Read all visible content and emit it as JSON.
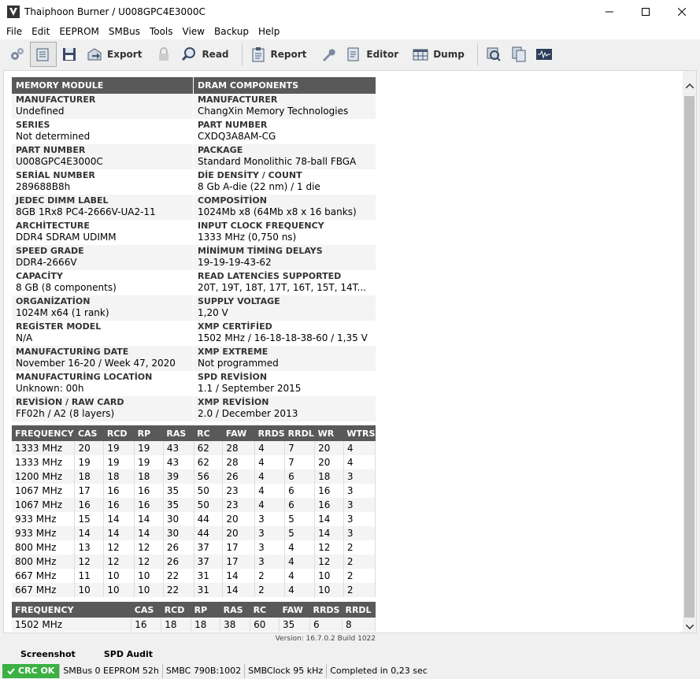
{
  "window": {
    "title": "Thaiphoon Burner / U008GPC4E3000C"
  },
  "menu": [
    "File",
    "Edit",
    "EEPROM",
    "SMBus",
    "Tools",
    "View",
    "Backup",
    "Help"
  ],
  "toolbar": {
    "export": "Export",
    "read": "Read",
    "report": "Report",
    "editor": "Editor",
    "dump": "Dump"
  },
  "headers": {
    "left": "MEMORY MODULE",
    "right": "DRAM COMPONENTS"
  },
  "pairs": [
    [
      {
        "label": "MANUFACTURER",
        "value": "Undefined"
      },
      {
        "label": "MANUFACTURER",
        "value": "ChangXin Memory Technologies"
      }
    ],
    [
      {
        "label": "SERIES",
        "value": "Not determined"
      },
      {
        "label": "PART NUMBER",
        "value": "CXDQ3A8AM-CG"
      }
    ],
    [
      {
        "label": "PART NUMBER",
        "value": "U008GPC4E3000C"
      },
      {
        "label": "PACKAGE",
        "value": "Standard Monolithic 78-ball FBGA"
      }
    ],
    [
      {
        "label": "SERİAL NUMBER",
        "value": "289688B8h"
      },
      {
        "label": "DİE DENSİTY / COUNT",
        "value": "8 Gb A-die (22 nm) / 1 die"
      }
    ],
    [
      {
        "label": "JEDEC DIMM LABEL",
        "value": "8GB 1Rx8 PC4-2666V-UA2-11"
      },
      {
        "label": "COMPOSİTİON",
        "value": "1024Mb x8 (64Mb x8 x 16 banks)"
      }
    ],
    [
      {
        "label": "ARCHİTECTURE",
        "value": "DDR4 SDRAM UDIMM"
      },
      {
        "label": "INPUT CLOCK FREQUENCY",
        "value": "1333 MHz (0,750 ns)"
      }
    ],
    [
      {
        "label": "SPEED GRADE",
        "value": "DDR4-2666V"
      },
      {
        "label": "MİNİMUM TİMİNG DELAYS",
        "value": "19-19-19-43-62"
      }
    ],
    [
      {
        "label": "CAPACİTY",
        "value": "8 GB (8 components)"
      },
      {
        "label": "READ LATENCİES SUPPORTED",
        "value": "20T, 19T, 18T, 17T, 16T, 15T, 14T..."
      }
    ],
    [
      {
        "label": "ORGANİZATİON",
        "value": "1024M x64 (1 rank)"
      },
      {
        "label": "SUPPLY VOLTAGE",
        "value": "1,20 V"
      }
    ],
    [
      {
        "label": "REGİSTER MODEL",
        "value": "N/A"
      },
      {
        "label": "XMP CERTİFİED",
        "value": "1502 MHz / 16-18-18-38-60 / 1,35 V"
      }
    ],
    [
      {
        "label": "MANUFACTURİNG DATE",
        "value": "November 16-20 / Week 47, 2020"
      },
      {
        "label": "XMP EXTREME",
        "value": "Not programmed"
      }
    ],
    [
      {
        "label": "MANUFACTURİNG LOCATİON",
        "value": "Unknown: 00h"
      },
      {
        "label": "SPD REVİSİON",
        "value": "1.1 / September 2015"
      }
    ],
    [
      {
        "label": "REVİSİON / RAW CARD",
        "value": "FF02h / A2 (8 layers)"
      },
      {
        "label": "XMP REVİSİON",
        "value": "2.0 / December 2013"
      }
    ]
  ],
  "timings": {
    "columns": [
      "FREQUENCY",
      "CAS",
      "RCD",
      "RP",
      "RAS",
      "RC",
      "FAW",
      "RRDS",
      "RRDL",
      "WR",
      "WTRS"
    ],
    "rows": [
      [
        "1333 MHz",
        "20",
        "19",
        "19",
        "43",
        "62",
        "28",
        "4",
        "7",
        "20",
        "4"
      ],
      [
        "1333 MHz",
        "19",
        "19",
        "19",
        "43",
        "62",
        "28",
        "4",
        "7",
        "20",
        "4"
      ],
      [
        "1200 MHz",
        "18",
        "18",
        "18",
        "39",
        "56",
        "26",
        "4",
        "6",
        "18",
        "3"
      ],
      [
        "1067 MHz",
        "17",
        "16",
        "16",
        "35",
        "50",
        "23",
        "4",
        "6",
        "16",
        "3"
      ],
      [
        "1067 MHz",
        "16",
        "16",
        "16",
        "35",
        "50",
        "23",
        "4",
        "6",
        "16",
        "3"
      ],
      [
        "933 MHz",
        "15",
        "14",
        "14",
        "30",
        "44",
        "20",
        "3",
        "5",
        "14",
        "3"
      ],
      [
        "933 MHz",
        "14",
        "14",
        "14",
        "30",
        "44",
        "20",
        "3",
        "5",
        "14",
        "3"
      ],
      [
        "800 MHz",
        "13",
        "12",
        "12",
        "26",
        "37",
        "17",
        "3",
        "4",
        "12",
        "2"
      ],
      [
        "800 MHz",
        "12",
        "12",
        "12",
        "26",
        "37",
        "17",
        "3",
        "4",
        "12",
        "2"
      ],
      [
        "667 MHz",
        "11",
        "10",
        "10",
        "22",
        "31",
        "14",
        "2",
        "4",
        "10",
        "2"
      ],
      [
        "667 MHz",
        "10",
        "10",
        "10",
        "22",
        "31",
        "14",
        "2",
        "4",
        "10",
        "2"
      ]
    ]
  },
  "xmp": {
    "columns": [
      "FREQUENCY",
      "CAS",
      "RCD",
      "RP",
      "RAS",
      "RC",
      "FAW",
      "RRDS",
      "RRDL"
    ],
    "rows": [
      [
        "1502 MHz",
        "16",
        "18",
        "18",
        "38",
        "60",
        "35",
        "6",
        "8"
      ]
    ]
  },
  "version": "Version: 16.7.0.2 Build 1022",
  "tabs": [
    "Screenshot",
    "SPD Audit"
  ],
  "status": {
    "crc": "CRC OK",
    "smbus": "SMBus 0 EEPROM 52h",
    "smbc": "SMBC 790B:1002",
    "clock": "SMBClock 95 kHz",
    "completed": "Completed in 0,23 sec"
  }
}
